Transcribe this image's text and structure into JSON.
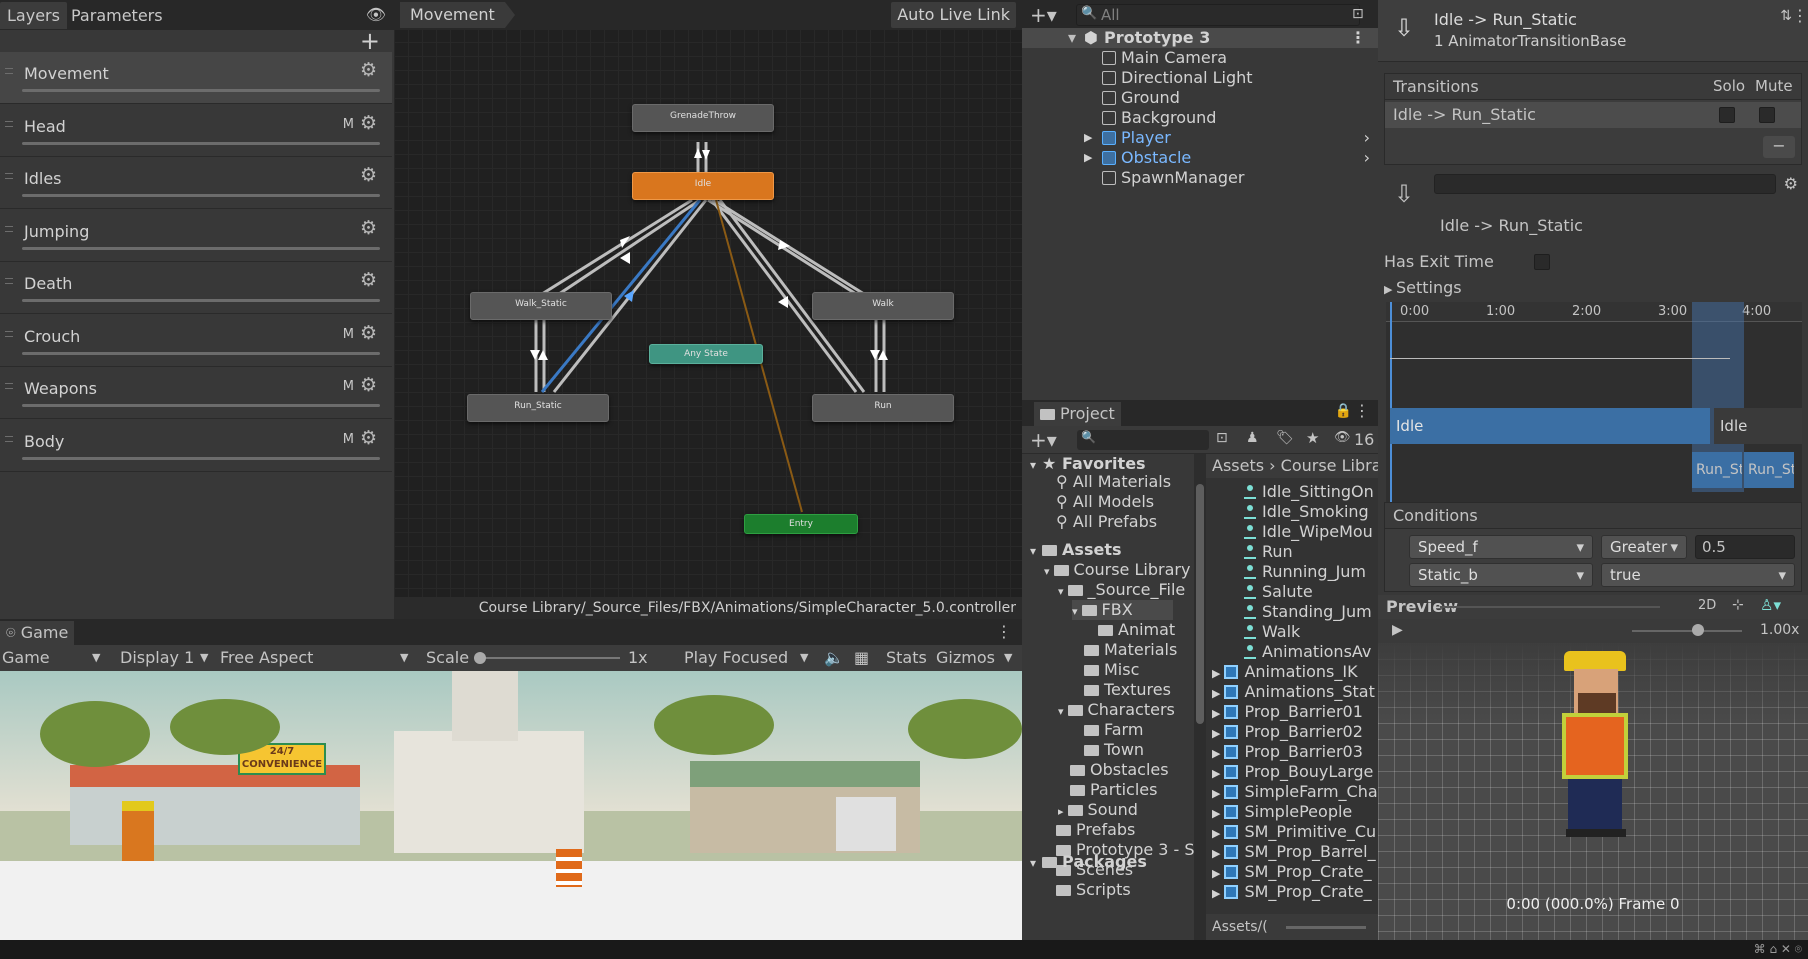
{
  "animator": {
    "tabs": [
      "Layers",
      "Parameters"
    ],
    "layers": [
      {
        "name": "Movement",
        "mask": false
      },
      {
        "name": "Head",
        "mask": true
      },
      {
        "name": "Idles",
        "mask": false
      },
      {
        "name": "Jumping",
        "mask": false
      },
      {
        "name": "Death",
        "mask": false
      },
      {
        "name": "Crouch",
        "mask": true
      },
      {
        "name": "Weapons",
        "mask": true
      },
      {
        "name": "Body",
        "mask": true
      }
    ],
    "mask_flag": "M",
    "breadcrumb": "Movement",
    "auto_live_link": "Auto Live Link",
    "nodes": {
      "grenade": "GrenadeThrow",
      "idle": "Idle",
      "walk_static": "Walk_Static",
      "walk": "Walk",
      "any_state": "Any State",
      "run_static": "Run_Static",
      "run": "Run",
      "entry": "Entry"
    },
    "controller_path": "Course Library/_Source_Files/FBX/Animations/SimpleCharacter_5.0.controller"
  },
  "hierarchy": {
    "search_placeholder": "All",
    "scene": "Prototype 3",
    "items": [
      "Main Camera",
      "Directional Light",
      "Ground",
      "Background",
      "Player",
      "Obstacle",
      "SpawnManager"
    ]
  },
  "project": {
    "tab": "Project",
    "hidden_count": "16",
    "favorites_label": "Favorites",
    "favorites": [
      "All Materials",
      "All Models",
      "All Prefabs"
    ],
    "assets_label": "Assets",
    "tree": [
      "Course Library",
      "_Source_File",
      "FBX",
      "Animat",
      "Materials",
      "Misc",
      "Textures",
      "Characters",
      "Farm",
      "Town",
      "Obstacles",
      "Particles",
      "Sound",
      "Prefabs",
      "Prototype 3 - S",
      "Scenes",
      "Scripts"
    ],
    "packages_label": "Packages",
    "breadcrumb": [
      "Assets",
      "Course Librar"
    ],
    "files": [
      "Idle_SittingOn",
      "Idle_Smoking",
      "Idle_WipeMou",
      "Run",
      "Running_Jum",
      "Salute",
      "Standing_Jum",
      "Walk",
      "AnimationsAv"
    ],
    "models": [
      "Animations_IK",
      "Animations_Stat",
      "Prop_Barrier01",
      "Prop_Barrier02",
      "Prop_Barrier03",
      "Prop_BouyLarge",
      "SimpleFarm_Cha",
      "SimplePeople",
      "SM_Primitive_Cu",
      "SM_Prop_Barrel_",
      "SM_Prop_Crate_",
      "SM_Prop_Crate_"
    ],
    "footer_path": "Assets/("
  },
  "inspector": {
    "title": "Idle -> Run_Static",
    "subtitle": "1 AnimatorTransitionBase",
    "transitions_header": "Transitions",
    "solo": "Solo",
    "mute": "Mute",
    "transition_row": "Idle -> Run_Static",
    "transition_name": "Idle -> Run_Static",
    "has_exit_time": "Has Exit Time",
    "settings": "Settings",
    "timeline_ticks": [
      "0:00",
      "1:00",
      "2:00",
      "3:00",
      "4:00"
    ],
    "clip_idle": "Idle",
    "clip_idle2": "Idle",
    "clip_run1": "Run_St",
    "clip_run2": "Run_St",
    "conditions_header": "Conditions",
    "conditions": [
      {
        "param": "Speed_f",
        "op": "Greater",
        "value": "0.5"
      },
      {
        "param": "Static_b",
        "op": "true",
        "value": ""
      }
    ]
  },
  "preview": {
    "title": "Preview",
    "mode_2d": "2D",
    "speed": "1.00x",
    "frame": "0:00 (000.0%) Frame 0"
  },
  "game": {
    "tab": "Game",
    "mode": "Game",
    "display": "Display 1",
    "aspect": "Free Aspect",
    "scale_label": "Scale",
    "scale_value": "1x",
    "play_focused": "Play Focused",
    "stats": "Stats",
    "gizmos": "Gizmos",
    "sign_247": "24/7",
    "sign_conv": "CONVENIENCE"
  },
  "colors": {
    "accent": "#d9761e",
    "selection_blue": "#3d6fa0",
    "teal": "#3f9582",
    "entry": "#1c7e2d"
  }
}
